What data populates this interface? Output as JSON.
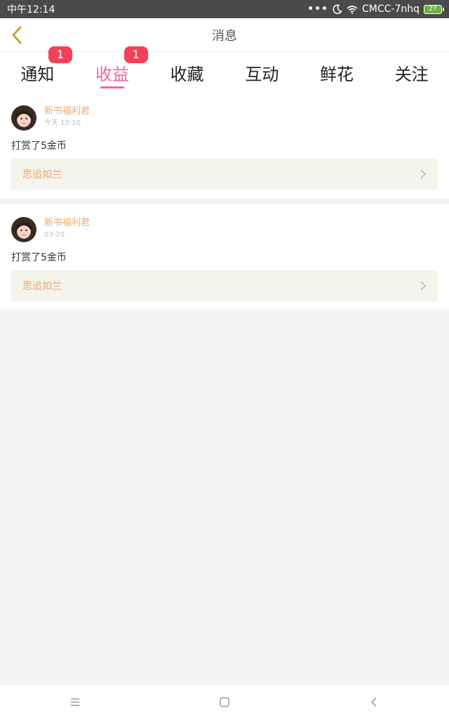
{
  "status_bar": {
    "time": "中午12:14",
    "carrier": "CMCC-7nhq",
    "battery": "27",
    "dots": "•••",
    "icons": [
      "moon-icon",
      "wifi-icon",
      "battery-icon"
    ]
  },
  "header": {
    "title": "消息",
    "back_icon": "chevron-left-icon",
    "back_color": "#c8a233"
  },
  "tabs": [
    {
      "label": "通知",
      "badge": "1",
      "active": false
    },
    {
      "label": "收益",
      "badge": "1",
      "active": true
    },
    {
      "label": "收藏",
      "badge": "",
      "active": false
    },
    {
      "label": "互动",
      "badge": "",
      "active": false
    },
    {
      "label": "鲜花",
      "badge": "",
      "active": false
    },
    {
      "label": "关注",
      "badge": "",
      "active": false
    }
  ],
  "messages": [
    {
      "sender": "新书福利君",
      "time": "今天 12:10",
      "text": "打赏了5金币",
      "book": "思追如兰"
    },
    {
      "sender": "新书福利君",
      "time": "03-20",
      "text": "打赏了5金币",
      "book": "思追如兰"
    }
  ],
  "bottom_nav": {
    "icons": [
      "menu-icon",
      "home-square-icon",
      "back-triangle-icon"
    ]
  },
  "colors": {
    "accent": "#e76aa2",
    "badge": "#f24156",
    "sender": "#eea96f",
    "book_bg": "#f4f3ec"
  }
}
